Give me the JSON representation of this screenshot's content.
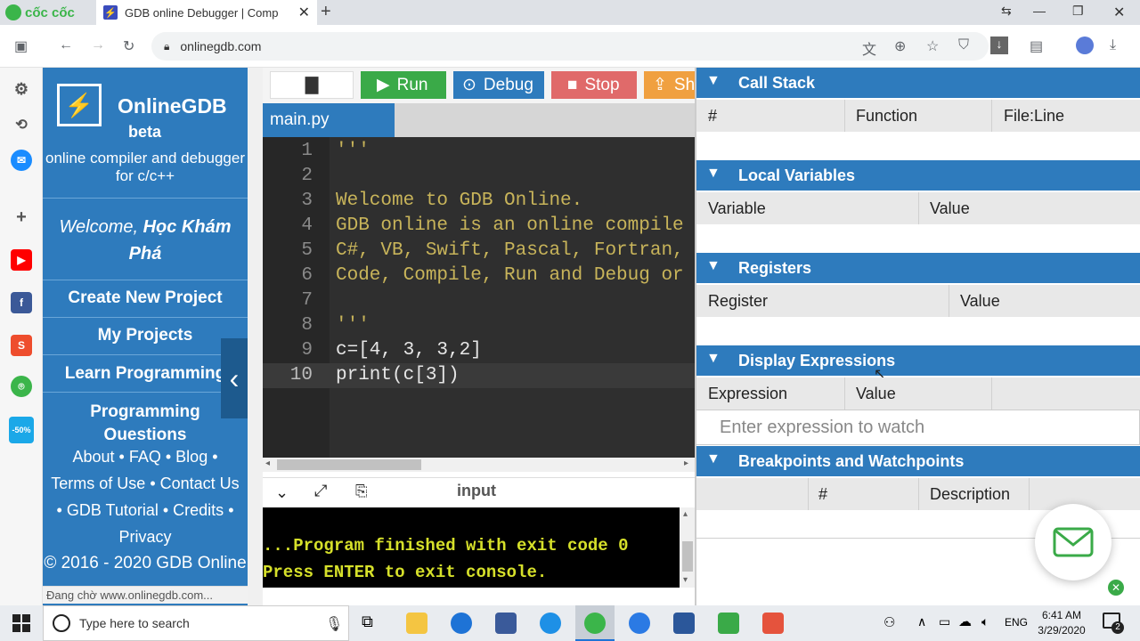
{
  "browser": {
    "brand": "cốc cốc",
    "tab_title": "GDB online Debugger | Comp",
    "url": "onlinegdb.com"
  },
  "nav": {
    "brand": "OnlineGDB",
    "beta": "beta",
    "tagline": "online compiler and debugger for c/c++",
    "welcome_prefix": "Welcome,",
    "welcome_name": "Học Khám Phá",
    "items": [
      {
        "label": "Create New Project"
      },
      {
        "label": "My Projects"
      },
      {
        "label": "Learn Programming"
      },
      {
        "label": "Programming Questions"
      }
    ],
    "footer_links": [
      "About",
      "FAQ",
      "Blog",
      "Terms of Use",
      "Contact Us",
      "GDB Tutorial",
      "Credits",
      "Privacy"
    ],
    "copyright": "© 2016 - 2020 GDB Online"
  },
  "editor_toolbar": {
    "run": "Run",
    "debug": "Debug",
    "stop": "Stop",
    "share": "Sh"
  },
  "file_tab": "main.py",
  "code_lines": [
    "'''",
    "",
    "Welcome to GDB Online.",
    "GDB online is an online compile",
    "C#, VB, Swift, Pascal, Fortran,",
    "Code, Compile, Run and Debug or",
    "",
    "'''",
    "c=[4, 3, 3,2]",
    "print(c[3])"
  ],
  "line_numbers": [
    "1",
    "2",
    "3",
    "4",
    "5",
    "6",
    "7",
    "8",
    "9",
    "10"
  ],
  "console": {
    "tab_label": "input",
    "lines": [
      "...Program finished with exit code 0",
      "Press ENTER to exit console."
    ]
  },
  "debugger": {
    "call_stack": {
      "title": "Call Stack",
      "cols": [
        "#",
        "Function",
        "File:Line"
      ]
    },
    "local_vars": {
      "title": "Local Variables",
      "cols": [
        "Variable",
        "Value"
      ]
    },
    "registers": {
      "title": "Registers",
      "cols": [
        "Register",
        "Value"
      ]
    },
    "display_expr": {
      "title": "Display Expressions",
      "cols": [
        "Expression",
        "Value"
      ],
      "placeholder": "Enter expression to watch"
    },
    "breakpoints": {
      "title": "Breakpoints and Watchpoints",
      "cols": [
        "#",
        "Description"
      ]
    }
  },
  "status_bar": "Đang chờ www.onlinegdb.com...",
  "taskbar": {
    "search_placeholder": "Type here to search",
    "lang": "ENG",
    "time": "6:41 AM",
    "date": "3/29/2020",
    "notif_count": "2"
  },
  "colors": {
    "nav_blue": "#2e7bbd",
    "run_green": "#3aaa48",
    "debug_blue": "#2e7bbd",
    "stop_red": "#e06a6a",
    "share_orange": "#f0a040",
    "console_text": "#d6e02a"
  }
}
